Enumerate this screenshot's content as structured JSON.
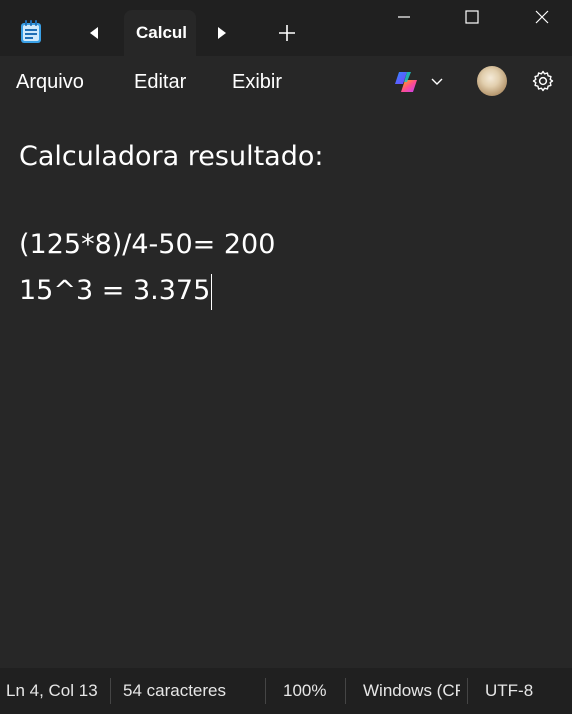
{
  "titlebar": {
    "tab_title": "Calcul",
    "icons": {
      "app": "notepad-icon",
      "prev": "caret-left-icon",
      "next": "caret-right-icon",
      "add": "plus-icon",
      "minimize": "minimize-icon",
      "maximize": "maximize-icon",
      "close": "close-icon"
    }
  },
  "menu": {
    "items": [
      "Arquivo",
      "Editar",
      "Exibir"
    ],
    "icons": {
      "copilot": "copilot-icon",
      "copilot_menu": "chevron-down-icon",
      "profile": "avatar",
      "settings": "gear-icon"
    }
  },
  "editor": {
    "lines": [
      "Calculadora resultado:",
      "",
      "(125*8)/4-50= 200",
      "15^3 = 3.375"
    ]
  },
  "status": {
    "position": "Ln 4, Col 13",
    "characters": "54 caracteres",
    "zoom": "100%",
    "line_ending": "Windows (CRLF)",
    "encoding": "UTF-8"
  },
  "colors": {
    "editor_bg": "#272727",
    "titlebar_bg": "#202020",
    "text": "#ffffff"
  }
}
